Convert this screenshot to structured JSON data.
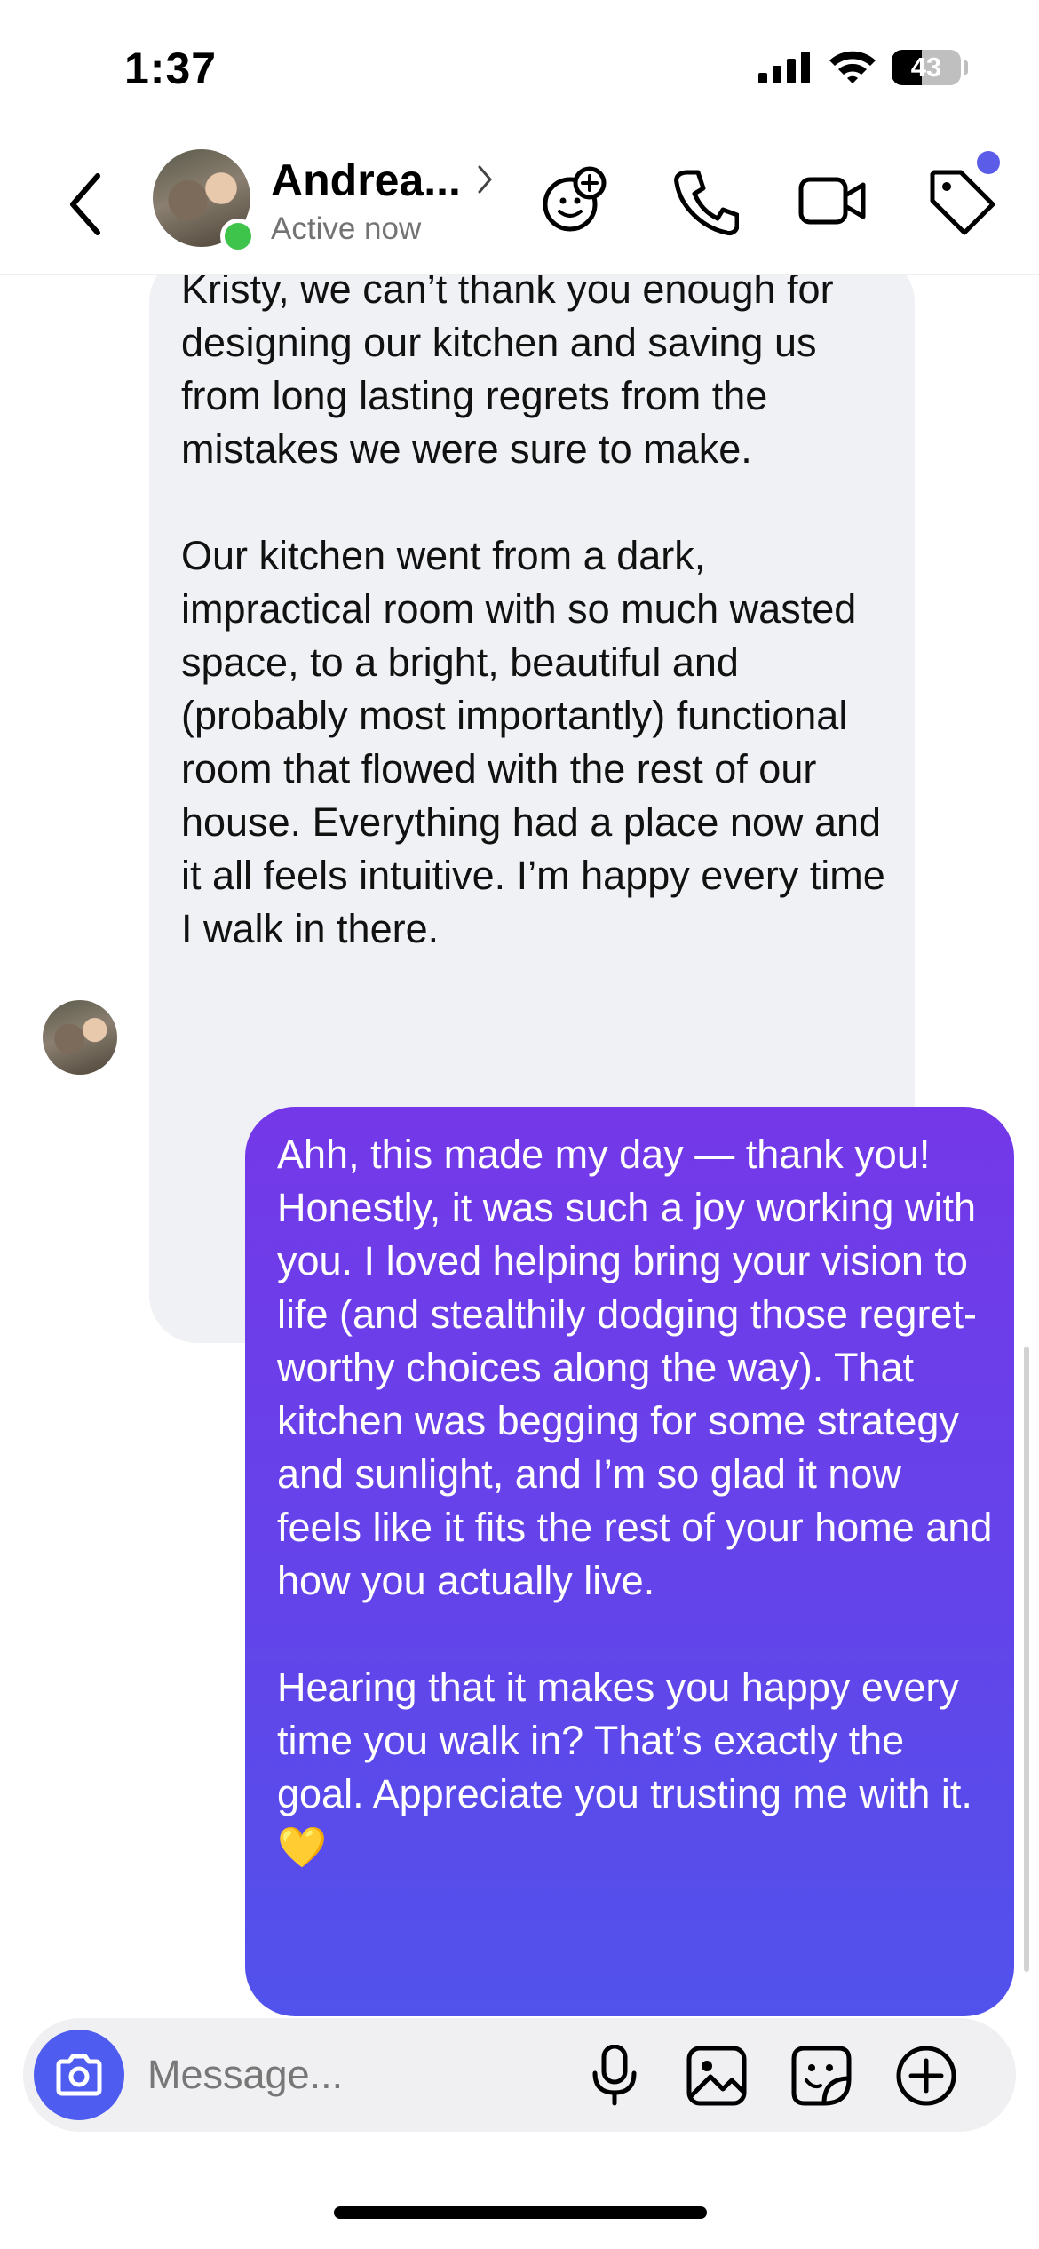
{
  "status_bar": {
    "time": "1:37",
    "battery_percent": "43",
    "battery_level": 0.43
  },
  "header": {
    "contact_name": "Andrea...",
    "status": "Active now",
    "icons": [
      "back-chevron-icon",
      "effects-icon",
      "phone-icon",
      "video-camera-icon",
      "tag-icon"
    ],
    "online_color": "#3ec44a",
    "notification_dot_color": "#5b5ce8"
  },
  "messages": [
    {
      "direction": "incoming",
      "text": "Kristy, we can’t thank you enough for designing our kitchen and saving us from long lasting regrets from the mistakes we were sure to make.\n\nOur kitchen went from a dark, impractical room with so much wasted space, to a bright, beautiful and (probably most importantly) functional room that flowed with the rest of our house. Everything had a place now and it all feels intuitive. I’m happy every time I walk in there."
    },
    {
      "direction": "outgoing",
      "text": "Ahh, this made my day — thank you! Honestly, it was such a joy working with you. I loved helping bring your vision to life (and stealthily dodging those regret-worthy choices along the way). That kitchen was begging for some strategy and sunlight, and I’m so glad it now feels like it fits the rest of your home and how you actually live.\n\nHearing that it makes you happy every time you walk in? That’s exactly the goal. Appreciate you trusting me with it. ",
      "emoji": "💛"
    }
  ],
  "composer": {
    "placeholder": "Message...",
    "icons": [
      "camera-icon",
      "microphone-icon",
      "gallery-icon",
      "sticker-icon",
      "plus-icon"
    ]
  },
  "colors": {
    "outgoing_top": "#7438e8",
    "outgoing_bottom": "#5152ec",
    "incoming_bg": "#f0f1f4",
    "camera_button": "#4e5cf0"
  }
}
